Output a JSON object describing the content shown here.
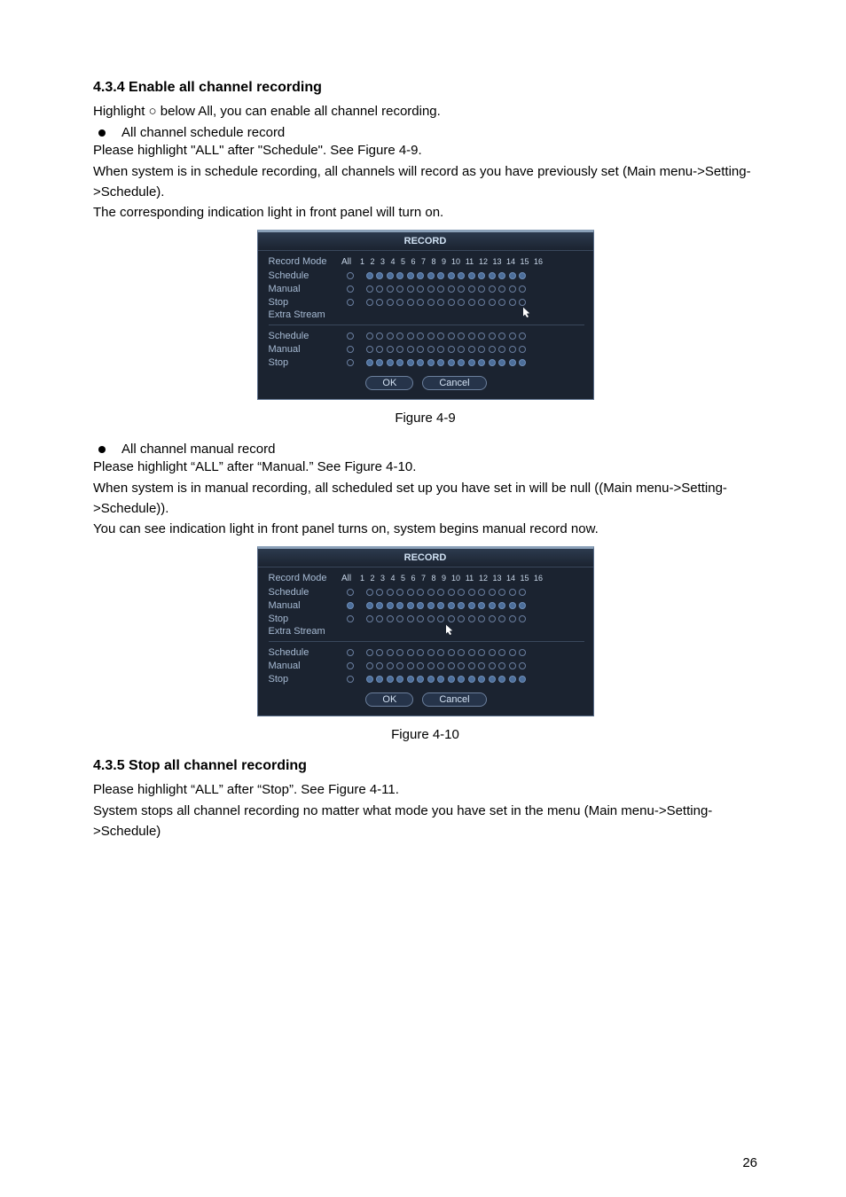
{
  "section434": {
    "heading": "4.3.4  Enable all channel recording",
    "line1_prefix": "Highlight ",
    "line1_circle": "○",
    "line1_suffix": " below All, you can enable all channel recording.",
    "bullet1": "All channel schedule record",
    "p2": "Please highlight \"ALL\" after \"Schedule\". See Figure 4-9.",
    "p3": "When system is in schedule recording, all channels will record as you have previously set (Main menu->Setting->Schedule).",
    "p4": "The corresponding indication light in front panel will turn on."
  },
  "figure49": {
    "caption": "Figure 4-9",
    "title": "RECORD",
    "header_label": "Record Mode",
    "header_all": "All",
    "channels": [
      "1",
      "2",
      "3",
      "4",
      "5",
      "6",
      "7",
      "8",
      "9",
      "10",
      "11",
      "12",
      "13",
      "14",
      "15",
      "16"
    ],
    "main_rows": [
      {
        "label": "Schedule",
        "all": false,
        "filled": true
      },
      {
        "label": "Manual",
        "all": false,
        "filled": false
      },
      {
        "label": "Stop",
        "all": false,
        "filled": false
      }
    ],
    "extra_label": "Extra Stream",
    "extra_rows": [
      {
        "label": "Schedule",
        "all": false,
        "filled": false
      },
      {
        "label": "Manual",
        "all": false,
        "filled": false
      },
      {
        "label": "Stop",
        "all": false,
        "filled": true
      }
    ],
    "ok": "OK",
    "cancel": "Cancel"
  },
  "mid": {
    "bullet": "All channel manual record",
    "p1": "Please highlight “ALL” after “Manual.” See Figure 4-10.",
    "p2": "When system is in manual recording, all scheduled set up you have set in will be null ((Main menu->Setting->Schedule)).",
    "p3": "You can see indication light in front panel turns on, system begins manual record now."
  },
  "figure410": {
    "caption": "Figure 4-10",
    "title": "RECORD",
    "header_label": "Record Mode",
    "header_all": "All",
    "channels": [
      "1",
      "2",
      "3",
      "4",
      "5",
      "6",
      "7",
      "8",
      "9",
      "10",
      "11",
      "12",
      "13",
      "14",
      "15",
      "16"
    ],
    "main_rows": [
      {
        "label": "Schedule",
        "all": false,
        "filled": false
      },
      {
        "label": "Manual",
        "all": true,
        "filled": true
      },
      {
        "label": "Stop",
        "all": false,
        "filled": false
      }
    ],
    "extra_label": "Extra Stream",
    "extra_rows": [
      {
        "label": "Schedule",
        "all": false,
        "filled": false
      },
      {
        "label": "Manual",
        "all": false,
        "filled": false
      },
      {
        "label": "Stop",
        "all": false,
        "filled": true
      }
    ],
    "ok": "OK",
    "cancel": "Cancel"
  },
  "section435": {
    "heading": "4.3.5  Stop all channel recording",
    "p1": "Please highlight “ALL” after “Stop”. See Figure 4-11.",
    "p2": "System stops all channel recording no matter what mode you have set in the menu (Main menu->Setting->Schedule)"
  },
  "page_number": "26"
}
